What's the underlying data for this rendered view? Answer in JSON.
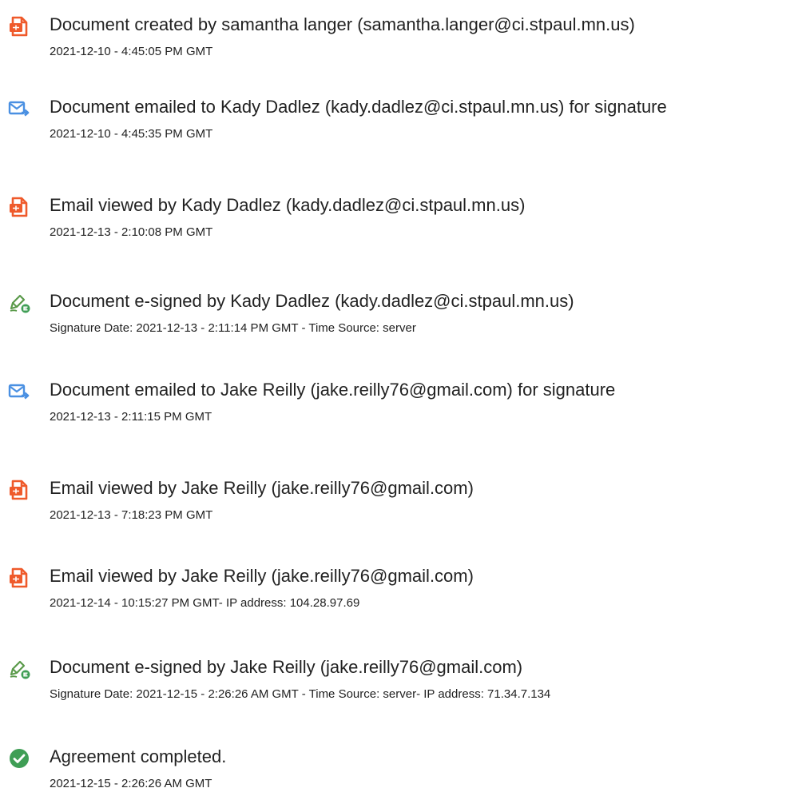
{
  "colors": {
    "document_icon": "#ef5a2b",
    "email_icon": "#4a90e2",
    "sign_icon": "#3f9e55",
    "complete_icon": "#3f9e55"
  },
  "events": [
    {
      "icon": "document-icon",
      "title": "Document created by samantha langer (samantha.langer@ci.stpaul.mn.us)",
      "detail": "2021-12-10 - 4:45:05 PM GMT"
    },
    {
      "icon": "email-send-icon",
      "title": "Document emailed to Kady Dadlez (kady.dadlez@ci.stpaul.mn.us) for signature",
      "detail": "2021-12-10 - 4:45:35 PM GMT"
    },
    {
      "icon": "document-icon",
      "title": "Email viewed by Kady Dadlez (kady.dadlez@ci.stpaul.mn.us)",
      "detail": "2021-12-13 - 2:10:08 PM GMT"
    },
    {
      "icon": "e-sign-icon",
      "title": "Document e-signed by Kady Dadlez (kady.dadlez@ci.stpaul.mn.us)",
      "detail": "Signature Date: 2021-12-13 - 2:11:14 PM GMT - Time Source: server"
    },
    {
      "icon": "email-send-icon",
      "title": "Document emailed to Jake Reilly (jake.reilly76@gmail.com) for signature",
      "detail": "2021-12-13 - 2:11:15 PM GMT"
    },
    {
      "icon": "document-icon",
      "title": "Email viewed by Jake Reilly (jake.reilly76@gmail.com)",
      "detail": "2021-12-13 - 7:18:23 PM GMT"
    },
    {
      "icon": "document-icon",
      "title": "Email viewed by Jake Reilly (jake.reilly76@gmail.com)",
      "detail": "2021-12-14 - 10:15:27 PM GMT- IP address: 104.28.97.69"
    },
    {
      "icon": "e-sign-icon",
      "title": "Document e-signed by Jake Reilly (jake.reilly76@gmail.com)",
      "detail": "Signature Date: 2021-12-15 - 2:26:26 AM GMT - Time Source: server- IP address: 71.34.7.134"
    },
    {
      "icon": "check-circle-icon",
      "title": "Agreement completed.",
      "detail": "2021-12-15 - 2:26:26 AM GMT"
    }
  ]
}
